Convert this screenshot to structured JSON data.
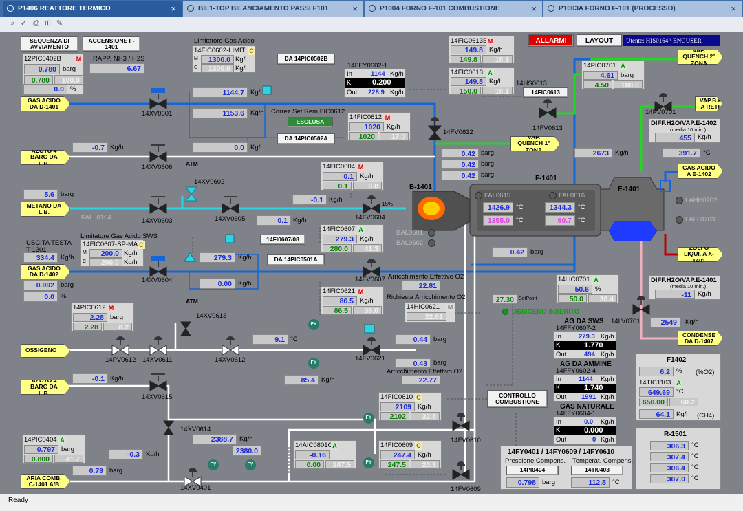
{
  "tabs": [
    {
      "label": "P1406 REATTORE TERMICO",
      "active": true
    },
    {
      "label": "BIL1-TOP BILANCIAMENTO PASSI F101"
    },
    {
      "label": "P1004 FORNO F-101 COMBUSTIONE"
    },
    {
      "label": "P1003A FORNO F-101 (PROCESSO)"
    }
  ],
  "toolbar_icons": [
    "zoom-icon",
    "check-icon",
    "print-icon",
    "network-icon",
    "edit-icon"
  ],
  "header": {
    "alarms": "ALLARMI",
    "layout": "LAYOUT",
    "user": "Utente: HIS0164 \\ ENGUSER"
  },
  "buttons": {
    "seq": "SEQUENZA DI AVVIAMENTO",
    "acc": "ACCENSIONE F-1401",
    "pic502b": "DA 14PIC0502B",
    "pic502a": "DA 14PIC0502A",
    "esclusa": "ESCLUSA",
    "fic613": "14FIC0613",
    "fi607": "14FI0607/08",
    "pic501a": "DA 14PIC0501A",
    "ctrl": "CONTROLLO COMBUSTIONE",
    "pi404": "14PI0404",
    "ti403": "14TI0403"
  },
  "pic402b": {
    "tag": "12PIC0402B",
    "m": "M",
    "pv": "0.780",
    "unit": "barg",
    "sp": "0.780",
    "out": "100.0",
    "pct": "0.0",
    "pct_unit": "%"
  },
  "rapp": {
    "label": "RAPP. NH3 / H2S",
    "value": "6.67"
  },
  "lim_gas": {
    "title": "Limitatore Gas Acido",
    "tag": "14FIC0602-LIMIT",
    "c": "C",
    "rowM": "M",
    "vM": "1300.0",
    "rowC": "C",
    "vC": "1300.0",
    "unit": "Kg/h"
  },
  "xv0601": {
    "tag": "14XV0601",
    "flow1": "1144.7",
    "flow2": "1153.6",
    "flow3": "0.0",
    "unit": "Kg/h"
  },
  "gas_acido_1401": "GAS ACIDO DA D-1401",
  "azoto1": "AZOTO 4 BARG DA L.B.",
  "xv0606": {
    "tag": "14XV0606",
    "flow": "-0.7",
    "unit": "Kg/h"
  },
  "atm1": "ATM",
  "atm2": "ATM",
  "xv0602": "14XV0602",
  "metano": {
    "label": "METANO DA L.B.",
    "pres": "5.6",
    "unit": "barg",
    "pall": "PALL0104"
  },
  "xv0603": "14XV0603",
  "xv0605": "14XV0605",
  "fic0604": {
    "tag": "14FIC0604",
    "m": "M",
    "pv": "0.1",
    "unit": "Kg/h",
    "sp": "0.1",
    "out": "0.0",
    "flow": "-0.1",
    "flow2": "0.1",
    "fv": "14FV0604",
    "pct": "15%"
  },
  "ffy0602": {
    "tag": "14FFY0602-1",
    "in_lbl": "In",
    "in": "1144",
    "k_lbl": "K",
    "k": "0.200",
    "out_lbl": "Out",
    "out": "228.9",
    "unit": "Kg/h"
  },
  "corr": "Correz.Set Rem.FIC0612",
  "fic0612": {
    "tag": "14FIC0612",
    "m": "M",
    "pv": "1020",
    "unit": "Kg/h",
    "sp": "1020",
    "out": "17.0",
    "fv": "14FV0612"
  },
  "fic0613b": {
    "tag": "14FIC0613B",
    "m": "M",
    "pv": "149.8",
    "unit": "Kg/h",
    "sp": "149.8",
    "out": "18.1"
  },
  "fic0613": {
    "tag": "14FIC0613",
    "a": "A",
    "pv": "149.8",
    "unit": "Kg/h",
    "sp": "150.0",
    "out": "18.1",
    "hs": "14HS0613",
    "fv": "14FV0613"
  },
  "vap_quench2": "VAP. QUENCH 2° ZONA",
  "pic0701": {
    "tag": "14PIC0701",
    "a": "A",
    "pv": "4.61",
    "unit": "barg",
    "sp": "4.50",
    "out": "100.0",
    "fv": "14PV0701"
  },
  "vap_bp": "VAP.B.P. A RETE",
  "vap_quench1": "VAP. QUENCH 1° ZONA",
  "pressures": {
    "p1": "0.42",
    "p2": "0.42",
    "p3": "0.42",
    "unit": "barg"
  },
  "b1401": "B-1401",
  "f1401": {
    "title": "F-1401",
    "fal615": "FAL0615",
    "fal616": "FAL0616",
    "t1": "1426.9",
    "t2": "1344.3",
    "t3": "1355.0",
    "t4": "60.7",
    "unit": "°C",
    "bal601": "BAL0601",
    "bal602": "BAL0602"
  },
  "e1401": {
    "title": "E-1401",
    "lahh": "LAHH0702",
    "lall": "LALL0703"
  },
  "flow2673": {
    "value": "2673",
    "unit": "Kg/h"
  },
  "t391": {
    "value": "391.7",
    "unit": "°C"
  },
  "diff1402": {
    "title": "DIFF.H2O/VAP.E-1402",
    "sub": "(media 10 min.)",
    "value": "455",
    "unit": "Kg/h"
  },
  "gas_acido_e1402": "GAS ACIDO A E-1402",
  "zolfo": "ZOLFO LIQUI. A X-1401",
  "lim_sws": {
    "title": "Limitatore Gas Acido SWS",
    "tag": "14FIC0607-SP-MAX",
    "c": "C",
    "rowM": "M",
    "vM": "200.0",
    "rowC": "C",
    "vC": "200.0",
    "unit": "Kg/h"
  },
  "uscita": {
    "label": "USCITA TESTA T-1301",
    "value": "334.4",
    "unit": "Kg/h"
  },
  "gas_acido_1402": "GAS ACIDO DA D-1402",
  "xv0604": {
    "tag": "14XV0604",
    "pres": "0.992",
    "punit": "barg",
    "pct": "0.0",
    "pctu": "%"
  },
  "sws_flow": {
    "v1": "279.3",
    "v2": "0.00",
    "unit": "Kg/h"
  },
  "fic0607": {
    "tag": "14FIC0607",
    "a": "A",
    "pv": "279.3",
    "unit": "Kg/h",
    "sp": "280.0",
    "out": "41.3",
    "fv": "14FV0607"
  },
  "arr1": {
    "label": "Arricchimento Effettivo O2",
    "value": "22.81"
  },
  "richiesta": {
    "label": "Richiesta Arricchimento O2",
    "tag": "14HIC0621",
    "m": "M",
    "value": "22.81"
  },
  "pressure042": {
    "value": "0.42",
    "unit": "barg"
  },
  "lic0701": {
    "tag": "14LIC0701",
    "a": "A",
    "pv": "50.6",
    "unit": "%",
    "sp": "50.0",
    "out": "30.4",
    "lv": "14LV0701"
  },
  "setpoint": {
    "value": "27.30",
    "label": "SetPoint"
  },
  "ossigeno_ins": "OSSIGENO INSERITO",
  "diff1401": {
    "title": "DIFF.H2O/VAP.E-1401",
    "sub": "(media 10 min.)",
    "value": "-11",
    "unit": "Kg/h"
  },
  "flow2549": {
    "value": "2549",
    "unit": "Kg/h"
  },
  "condense": "CONDENSE DA D-1407",
  "pic0612": {
    "tag": "14PIC0612",
    "m": "M",
    "pv": "2.28",
    "unit": "barg",
    "sp": "2.28",
    "out": "8.2",
    "pv_tag": "14PV0612"
  },
  "xv0613": "14XV0613",
  "ossigeno": "OSSIGENO",
  "xv0611": "14XV0611",
  "xv0612": "14XV0612",
  "temp91": {
    "value": "9.1",
    "unit": "°C"
  },
  "fic0621": {
    "tag": "14FIC0621",
    "m": "M",
    "pv": "86.5",
    "unit": "Kg/h",
    "sp": "86.5",
    "out": "36.0",
    "fv": "14FV0621"
  },
  "p044": {
    "value": "0.44",
    "unit": "barg"
  },
  "p043": {
    "value": "0.43",
    "unit": "barg"
  },
  "arr2": {
    "label": "Arricchimento Effettivo O2",
    "value": "22.77"
  },
  "flow854": {
    "value": "85.4",
    "unit": "Kg/h"
  },
  "azoto2": "AZOTO 4 BARG DA L.B.",
  "xv0615": {
    "tag": "14XV0615",
    "flow": "-0.1",
    "unit": "Kg/h"
  },
  "ag_sws": {
    "title": "AG DA SWS",
    "tag": "14FFY0607-2",
    "in": "279.3",
    "k": "1.770",
    "out": "494",
    "unit": "Kg/h"
  },
  "ag_amm": {
    "title": "AG DA AMMINE",
    "tag": "14FFY0602-4",
    "in": "1144",
    "k": "1.740",
    "out": "1991",
    "unit": "Kg/h"
  },
  "gas_nat": {
    "title": "GAS NATURALE",
    "tag": "14FFY0604-1",
    "in": "0.0",
    "k": "0.000",
    "out": "0",
    "unit": "Kg/h"
  },
  "lbl": {
    "in": "In",
    "k": "K",
    "out": "Out"
  },
  "fic0610": {
    "tag": "14FIC0610",
    "c": "C",
    "pv": "2109",
    "unit": "Kg/h",
    "sp": "2102",
    "out": "32.8",
    "fv": "14FV0610"
  },
  "f1402": {
    "title": "F1402",
    "o2": "6.2",
    "o2u": "%",
    "o2l": "(%O2)",
    "tic": "14TIC1103",
    "a": "A",
    "t": "649.69",
    "tu": "°C",
    "sp": "650.00",
    "out": "60.2",
    "ch4": "64.1",
    "ch4u": "Kg/h",
    "ch4l": "(CH4)"
  },
  "xv0614": {
    "tag": "14XV0614",
    "flow": "2388.7",
    "unit": "Kg/h",
    "flow2": "2380.0",
    "flow3": "-0.3"
  },
  "pic0404": {
    "tag": "14PIC0404",
    "a": "A",
    "pv": "0.797",
    "unit": "barg",
    "sp": "0.800",
    "out": "41.7",
    "pres": "0.79",
    "presu": "barg"
  },
  "aria": "ARIA COMB. C-1401 A/B",
  "xv0401": "14XV0401",
  "aic0801": {
    "tag": "14AIC0801C",
    "a": "A",
    "pv": "-0.16",
    "sp": "0.00",
    "out": "247.5"
  },
  "fic0609": {
    "tag": "14FIC0609",
    "c": "C",
    "pv": "247.4",
    "unit": "Kg/h",
    "sp": "247.5",
    "out": "20.3",
    "fv": "14FV0609"
  },
  "compens": {
    "title": "14FY0401 / 14FY0609 / 14FY0610",
    "l1": "Pressione Compens.",
    "l2": "Temperat. Compens.",
    "v1": "0.798",
    "u1": "barg",
    "v2": "112.5",
    "u2": "°C"
  },
  "r1501": {
    "title": "R-1501",
    "v1": "306.3",
    "v2": "307.4",
    "v3": "306.4",
    "v4": "307.0",
    "unit": "°C"
  },
  "status": "Ready",
  "colors": {
    "blue": "#1466d6",
    "cyan": "#2ad6e6",
    "white": "#ffffff",
    "green": "#22d622",
    "red": "#c00000",
    "pink": "#f0b0c0",
    "callout": "#ffff84"
  }
}
